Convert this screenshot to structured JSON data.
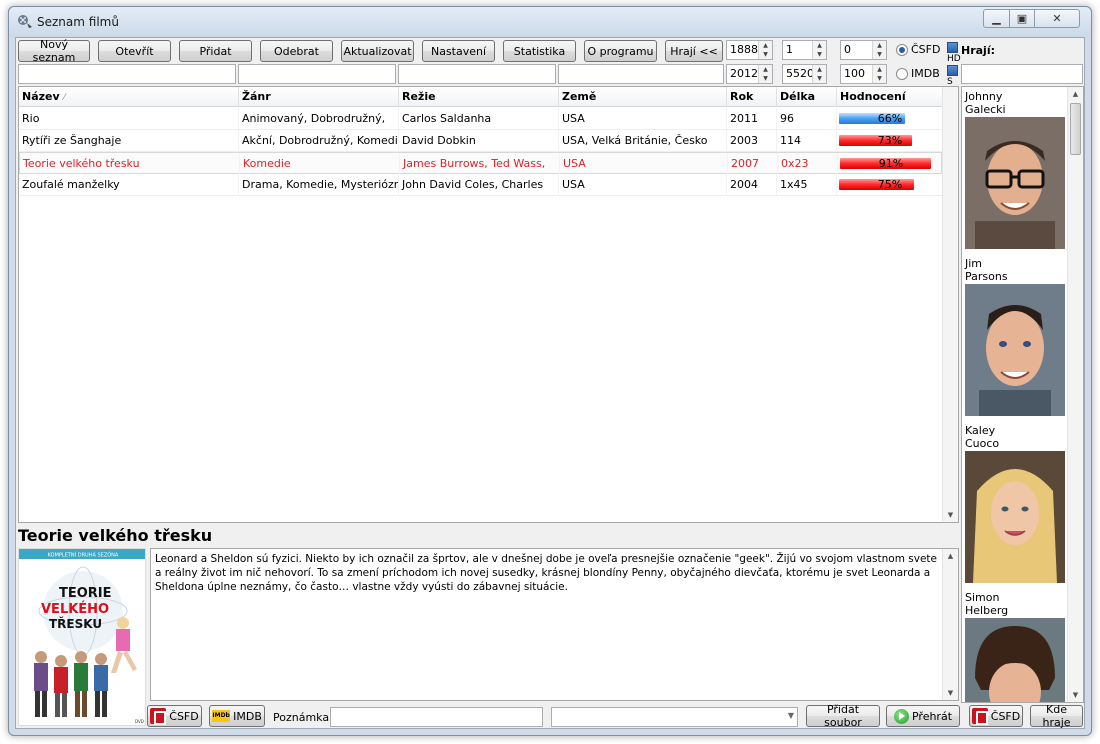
{
  "window": {
    "title": "Seznam filmů"
  },
  "toolbar": {
    "new_list": "Nový seznam",
    "open": "Otevřít",
    "add": "Přidat",
    "remove": "Odebrat",
    "update": "Aktualizovat",
    "settings": "Nastavení",
    "statistics": "Statistika",
    "about": "O programu",
    "cast_toggle": "Hrají <<"
  },
  "filters": {
    "year_from": "1888",
    "year_to": "2012",
    "length_from": "1",
    "length_to": "5520",
    "rating_from": "0",
    "rating_to": "100",
    "source_csfd": "ČSFD",
    "source_imdb": "IMDB",
    "hds_label_1": "HD",
    "hds_label_2": "S"
  },
  "table": {
    "columns": [
      "Název",
      "Žánr",
      "Režie",
      "Země",
      "Rok",
      "Délka",
      "Hodnocení"
    ],
    "rows": [
      {
        "title": "Rio",
        "genre": "Animovaný, Dobrodružný,",
        "director": "Carlos Saldanha",
        "country": "USA",
        "year": "2011",
        "length": "96",
        "rating": "66%",
        "rating_value": 66,
        "bar": "blue"
      },
      {
        "title": "Rytíři ze Šanghaje",
        "genre": "Akční, Dobrodružný, Komedie",
        "director": "David Dobkin",
        "country": "USA, Velká Británie, Česko",
        "year": "2003",
        "length": "114",
        "rating": "73%",
        "rating_value": 73,
        "bar": "red"
      },
      {
        "title": "Teorie velkého třesku",
        "genre": "Komedie",
        "director": "James Burrows, Ted Wass,",
        "country": "USA",
        "year": "2007",
        "length": "0x23",
        "rating": "91%",
        "rating_value": 91,
        "bar": "red"
      },
      {
        "title": "Zoufalé manželky",
        "genre": "Drama, Komedie, Mysteriózní",
        "director": "John David Coles, Charles",
        "country": "USA",
        "year": "2004",
        "length": "1x45",
        "rating": "75%",
        "rating_value": 75,
        "bar": "red"
      }
    ]
  },
  "detail": {
    "title": "Teorie velkého třesku",
    "poster_banner": "KOMPLETNÍ DRUHÁ SEZÓNA",
    "poster_title_1": "TEORIE",
    "poster_title_2": "VELKÉHO",
    "poster_title_3": "TŘESKU",
    "description": "Leonard a Sheldon sú fyzici. Niekto by ich označil za šprtov, ale v dnešnej dobe je oveľa presnejšie označenie \"geek\". Žijú vo svojom vlastnom svete a reálny život im nič nehovorí. To sa zmení príchodom ich novej susedky, krásnej blondíny Penny, obyčajného dievčaťa, ktorému je svet Leonarda a Sheldona úplne neznámy, čo často… vlastne vždy vyústi do zábavnej situácie."
  },
  "bottom": {
    "csfd": "ČSFD",
    "imdb": "IMDB",
    "imdb_logo": "IMDb",
    "note_label": "Poznámka:",
    "add_file": "Přidat soubor",
    "play": "Přehrát",
    "csfd2": "ČSFD",
    "where_playing": "Kde hraje"
  },
  "cast": {
    "label": "Hrají:",
    "actors": [
      {
        "name": "Johnny Galecki"
      },
      {
        "name": "Jim Parsons"
      },
      {
        "name": "Kaley Cuoco"
      },
      {
        "name": "Simon Helberg"
      }
    ]
  },
  "colors": {
    "selected_text": "#e0202a",
    "bar_blue": "#4aa0f0",
    "bar_red": "#ff2a2a"
  }
}
